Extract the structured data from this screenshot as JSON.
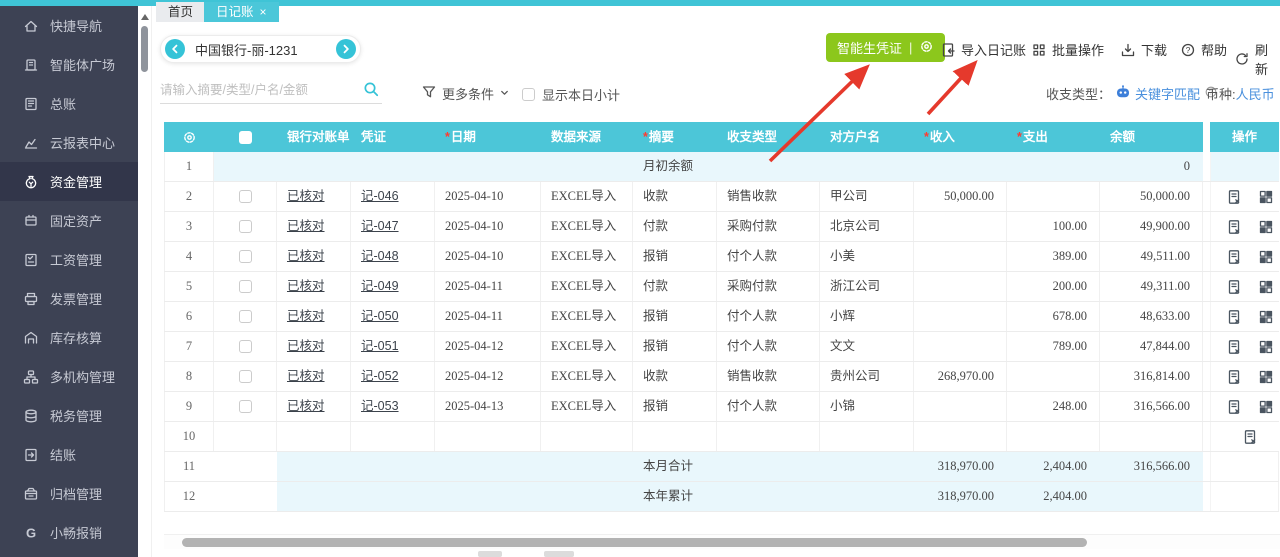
{
  "tabs": [
    {
      "label": "首页",
      "active": false
    },
    {
      "label": "日记账",
      "active": true,
      "close": "×"
    }
  ],
  "sidebar": {
    "items": [
      {
        "label": "快捷导航",
        "icon": "home",
        "active": false
      },
      {
        "label": "智能体广场",
        "icon": "agent-plaza",
        "active": false
      },
      {
        "label": "总账",
        "icon": "ledger",
        "active": false
      },
      {
        "label": "云报表中心",
        "icon": "cloud-report",
        "active": false
      },
      {
        "label": "资金管理",
        "icon": "funds",
        "active": true
      },
      {
        "label": "固定资产",
        "icon": "fixed-assets",
        "active": false
      },
      {
        "label": "工资管理",
        "icon": "payroll",
        "active": false
      },
      {
        "label": "发票管理",
        "icon": "invoice",
        "active": false
      },
      {
        "label": "库存核算",
        "icon": "inventory",
        "active": false
      },
      {
        "label": "多机构管理",
        "icon": "multi-org",
        "active": false
      },
      {
        "label": "税务管理",
        "icon": "tax",
        "active": false
      },
      {
        "label": "结账",
        "icon": "closing",
        "active": false
      },
      {
        "label": "归档管理",
        "icon": "archive",
        "active": false
      },
      {
        "label": "小畅报销",
        "icon": "xiaochang",
        "active": false
      }
    ]
  },
  "toolbar": {
    "account": "中国银行-丽-1231",
    "smart_voucher": "智能生凭证",
    "import_label": "导入日记账",
    "batch_label": "批量操作",
    "download_label": "下载",
    "help_label": "帮助",
    "refresh_label": "刷新"
  },
  "filters": {
    "search_placeholder": "请输入摘要/类型/户名/金额",
    "more_label": "更多条件",
    "show_daily_label": "显示本日小计",
    "type_label": "收支类型：",
    "keyword_match": "关键字匹配",
    "currency_label": "币种:",
    "currency": "人民币"
  },
  "table": {
    "headers": [
      {
        "label": "",
        "type": "gear"
      },
      {
        "label": "",
        "type": "checkbox"
      },
      {
        "label": "银行对账单"
      },
      {
        "label": "凭证"
      },
      {
        "label": "日期",
        "required": true
      },
      {
        "label": "数据来源"
      },
      {
        "label": "摘要",
        "required": true
      },
      {
        "label": "收支类型"
      },
      {
        "label": "对方户名"
      },
      {
        "label": "收入",
        "required": true
      },
      {
        "label": "支出",
        "required": true
      },
      {
        "label": "余额"
      },
      {
        "label": "操作"
      }
    ],
    "rows": [
      {
        "num": "1",
        "cb": false,
        "bank": "",
        "voucher": "",
        "date": "",
        "source": "",
        "summary": "月初余额",
        "type": "",
        "party": "",
        "income": "",
        "expense": "",
        "balance": "0",
        "ops": "",
        "style": "opening"
      },
      {
        "num": "2",
        "cb": true,
        "bank": "已核对",
        "voucher": "记-046",
        "date": "2025-04-10",
        "source": "EXCEL导入",
        "summary": "收款",
        "type": "销售收款",
        "party": "甲公司",
        "income": "50,000.00",
        "expense": "",
        "balance": "50,000.00",
        "ops": "full",
        "style": ""
      },
      {
        "num": "3",
        "cb": true,
        "bank": "已核对",
        "voucher": "记-047",
        "date": "2025-04-10",
        "source": "EXCEL导入",
        "summary": "付款",
        "type": "采购付款",
        "party": "北京公司",
        "income": "",
        "expense": "100.00",
        "balance": "49,900.00",
        "ops": "full",
        "style": ""
      },
      {
        "num": "4",
        "cb": true,
        "bank": "已核对",
        "voucher": "记-048",
        "date": "2025-04-10",
        "source": "EXCEL导入",
        "summary": "报销",
        "type": "付个人款",
        "party": "小美",
        "income": "",
        "expense": "389.00",
        "balance": "49,511.00",
        "ops": "full",
        "style": ""
      },
      {
        "num": "5",
        "cb": true,
        "bank": "已核对",
        "voucher": "记-049",
        "date": "2025-04-11",
        "source": "EXCEL导入",
        "summary": "付款",
        "type": "采购付款",
        "party": "浙江公司",
        "income": "",
        "expense": "200.00",
        "balance": "49,311.00",
        "ops": "full",
        "style": ""
      },
      {
        "num": "6",
        "cb": true,
        "bank": "已核对",
        "voucher": "记-050",
        "date": "2025-04-11",
        "source": "EXCEL导入",
        "summary": "报销",
        "type": "付个人款",
        "party": "小辉",
        "income": "",
        "expense": "678.00",
        "balance": "48,633.00",
        "ops": "full",
        "style": ""
      },
      {
        "num": "7",
        "cb": true,
        "bank": "已核对",
        "voucher": "记-051",
        "date": "2025-04-12",
        "source": "EXCEL导入",
        "summary": "报销",
        "type": "付个人款",
        "party": "文文",
        "income": "",
        "expense": "789.00",
        "balance": "47,844.00",
        "ops": "full",
        "style": ""
      },
      {
        "num": "8",
        "cb": true,
        "bank": "已核对",
        "voucher": "记-052",
        "date": "2025-04-12",
        "source": "EXCEL导入",
        "summary": "收款",
        "type": "销售收款",
        "party": "贵州公司",
        "income": "268,970.00",
        "expense": "",
        "balance": "316,814.00",
        "ops": "full",
        "style": ""
      },
      {
        "num": "9",
        "cb": true,
        "bank": "已核对",
        "voucher": "记-053",
        "date": "2025-04-13",
        "source": "EXCEL导入",
        "summary": "报销",
        "type": "付个人款",
        "party": "小锦",
        "income": "",
        "expense": "248.00",
        "balance": "316,566.00",
        "ops": "full",
        "style": ""
      },
      {
        "num": "10",
        "cb": false,
        "bank": "",
        "voucher": "",
        "date": "",
        "source": "",
        "summary": "",
        "type": "",
        "party": "",
        "income": "",
        "expense": "",
        "balance": "",
        "ops": "doc",
        "style": ""
      },
      {
        "num": "11",
        "cb": false,
        "bank": "",
        "voucher": "",
        "date": "",
        "source": "",
        "summary": "本月合计",
        "type": "",
        "party": "",
        "income": "318,970.00",
        "expense": "2,404.00",
        "balance": "316,566.00",
        "ops": "",
        "style": "summary"
      },
      {
        "num": "12",
        "cb": false,
        "bank": "",
        "voucher": "",
        "date": "",
        "source": "",
        "summary": "本年累计",
        "type": "",
        "party": "",
        "income": "318,970.00",
        "expense": "2,404.00",
        "balance": "",
        "ops": "",
        "style": "summary"
      }
    ]
  },
  "colors": {
    "accent_cyan": "#3fc4d6",
    "header_cyan": "#4cc6d8",
    "sidebar_bg": "#3d4254",
    "sidebar_active_bg": "#32364a",
    "green_button": "#8cc71c",
    "link_blue": "#4a90dd",
    "row_highlight": "#e9f7fc",
    "required_red": "#ff3b30",
    "annotation_red": "#e5392c"
  }
}
